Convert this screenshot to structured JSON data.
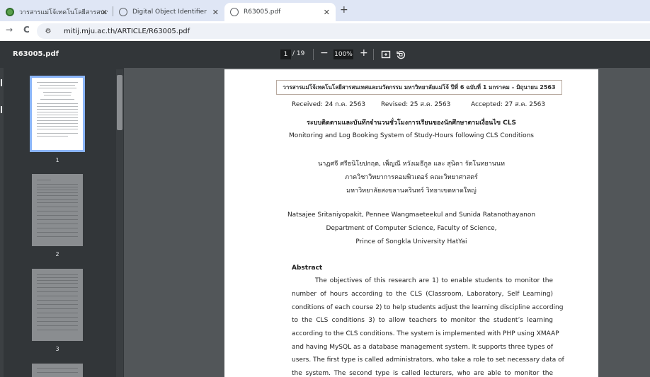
{
  "tabs": [
    {
      "title": "วารสารแม่โจ้เทคโนโลยีสารสนเทศ MJ",
      "close": "✕",
      "active": false
    },
    {
      "title": "Digital Object Identifier",
      "close": "✕",
      "active": false
    },
    {
      "title": "R63005.pdf",
      "close": "✕",
      "active": true
    }
  ],
  "browser": {
    "new_tab": "+",
    "back": "→",
    "reload": "C",
    "site_info": "⚙",
    "url": "mitij.mju.ac.th/ARTICLE/R63005.pdf"
  },
  "viewer": {
    "filename": "R63005.pdf",
    "current_page": "1",
    "total_pages": "/ 19",
    "zoom": "100%",
    "zoom_out": "−",
    "zoom_in": "+"
  },
  "thumbnails": [
    {
      "label": "1"
    },
    {
      "label": "2"
    },
    {
      "label": "3"
    }
  ],
  "document": {
    "journal_header": "วารสารแม่โจ้เทคโนโลยีสารสนเทศและนวัตกรรม มหาวิทยาลัยแม่โจ้ ปีที่ 6 ฉบับที่ 1 มกราคม – มิถุนายน 2563",
    "received": "Received: 24 ก.ค. 2563",
    "revised": "Revised: 25 ส.ค. 2563",
    "accepted": "Accepted: 27 ส.ค. 2563",
    "title_th": "ระบบติดตามและบันทึกจำนวนชั่วโมงการเรียนของนักศึกษาตามเงื่อนไข CLS",
    "title_en": "Monitoring and Log Booking System of Study-Hours following CLS Conditions",
    "authors_th": "นาฏศจี ศรีธนิโยปกฤต, เพ็ญณี หวังเมธีกูล และ สุนิดา รัตโนทยานนท",
    "dept_th": "ภาควิชาวิทยาการคอมพิวเตอร์ คณะวิทยาศาสตร์",
    "univ_th": "มหาวิทยาลัยสงขลานครินทร์ วิทยาเขตหาดใหญ่",
    "authors_en": "Natsajee Sritaniyopakit, Pennee Wangmaeteekul and Sunida Ratanothayanon",
    "dept_en": "Department of Computer Science, Faculty of Science,",
    "univ_en": "Prince of Songkla University HatYai",
    "abstract_heading": "Abstract",
    "abstract_lines": [
      "The objectives of this research are 1) to enable students to monitor the",
      "number of hours according to the CLS (Classroom, Laboratory, Self Learning)",
      "conditions of each course 2) to help students adjust the learning discipline according",
      "to the CLS conditions 3) to allow teachers to monitor the student’s learning",
      "according to the CLS conditions. The system is implemented with PHP using XMAAP",
      "and having MySQL as a database management system. It supports three types of",
      "users. The first type is called administrators, who take a role to set necessary data of",
      "the system. The second type is called lecturers, who are able to monitor the"
    ]
  },
  "colors": {
    "tabstrip": "#dfe6f5",
    "viewer_bar": "#323639",
    "doc_bg": "#525659",
    "thumb_highlight": "#8ab4f8"
  }
}
